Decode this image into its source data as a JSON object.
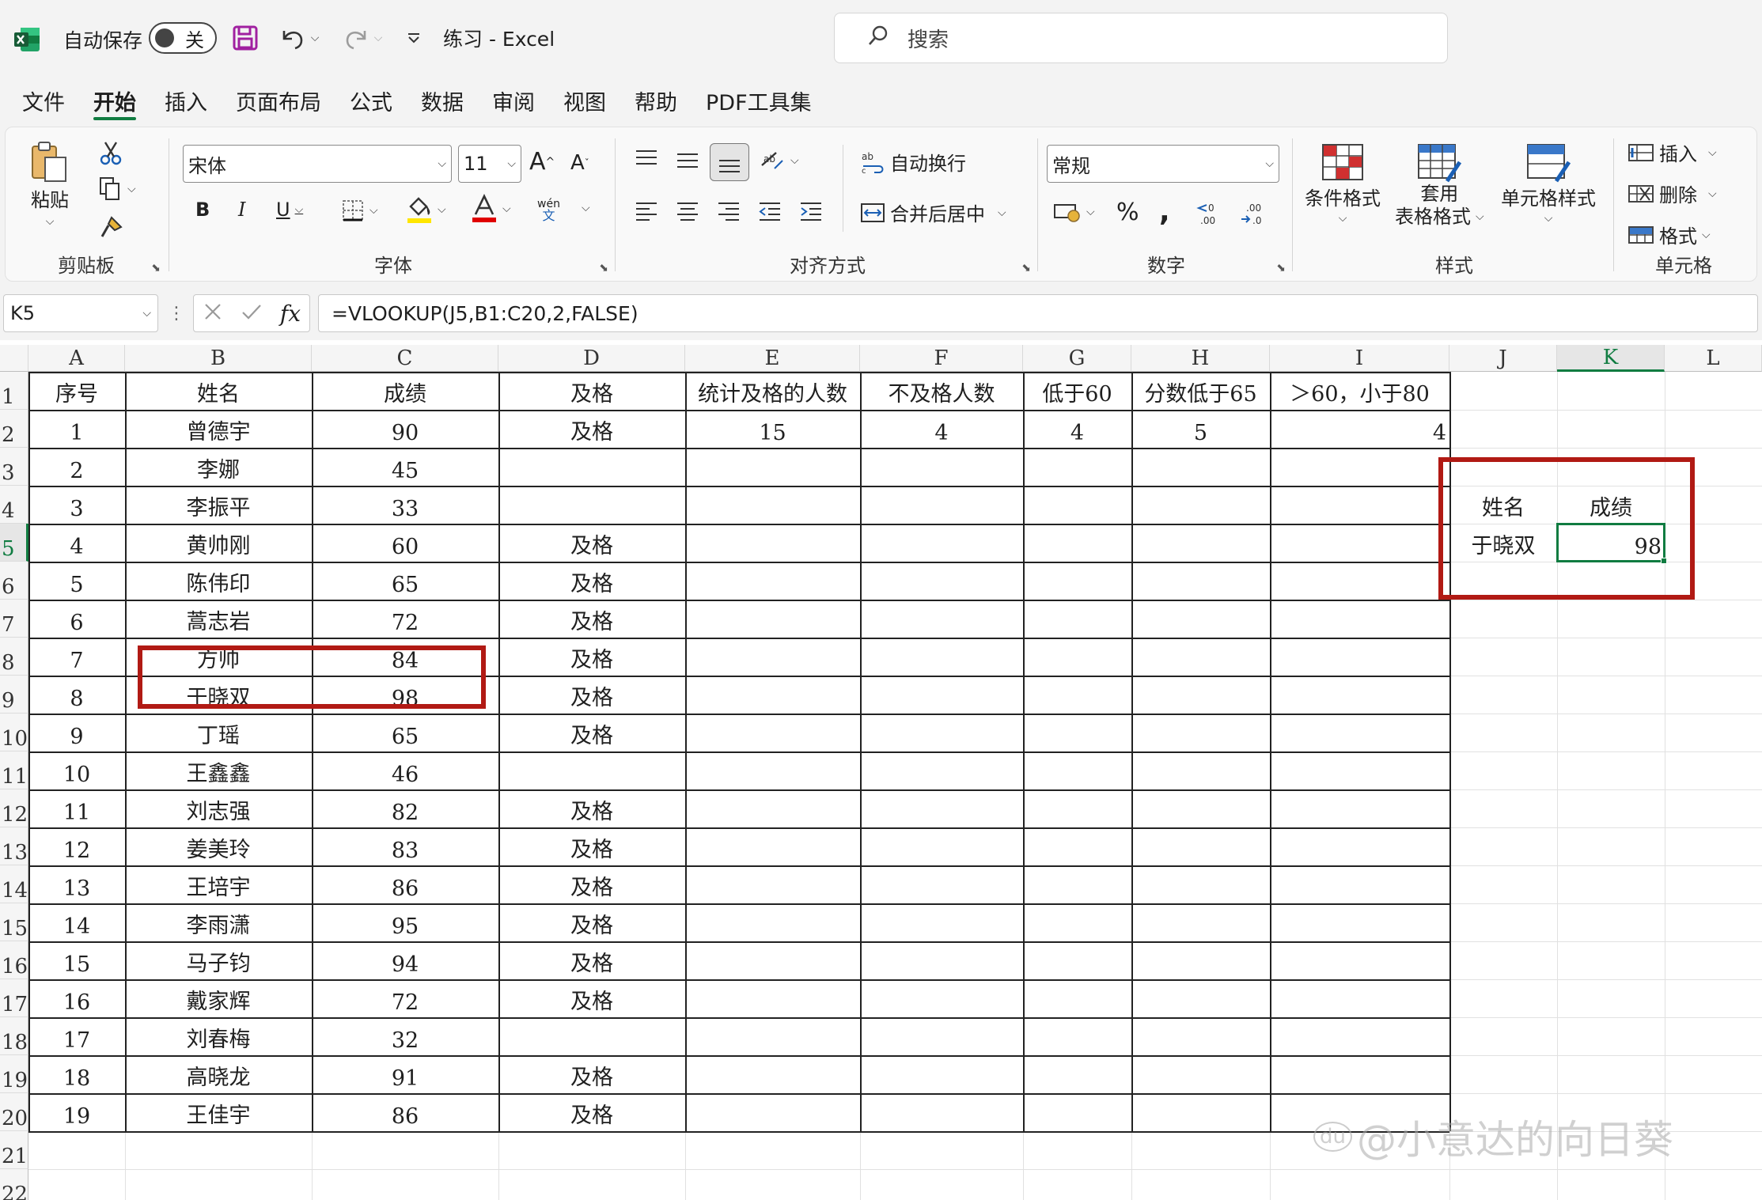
{
  "app": {
    "autosave_label": "自动保存",
    "autosave_state": "关",
    "doc_title": "练习  -  Excel",
    "search_placeholder": "搜索"
  },
  "tabs": [
    "文件",
    "开始",
    "插入",
    "页面布局",
    "公式",
    "数据",
    "审阅",
    "视图",
    "帮助",
    "PDF工具集"
  ],
  "ribbon": {
    "clipboard": {
      "label": "剪贴板",
      "paste": "粘贴"
    },
    "font": {
      "label": "字体",
      "font_name": "宋体",
      "font_size": "11",
      "bold": "B",
      "italic": "I",
      "underline": "U",
      "phonetic_top": "wén",
      "phonetic_bottom": "文",
      "font_color": "#e00000",
      "highlight_color": "#ffe600"
    },
    "alignment": {
      "label": "对齐方式",
      "wrap_text": "自动换行",
      "merge_center": "合并后居中"
    },
    "number": {
      "label": "数字",
      "format": "常规"
    },
    "styles": {
      "label": "样式",
      "conditional": "条件格式",
      "table_line1": "套用",
      "table_line2": "表格格式",
      "cell_styles": "单元格样式"
    },
    "cells": {
      "label": "单元格",
      "insert": "插入",
      "delete": "删除",
      "format": "格式"
    }
  },
  "formula_bar": {
    "name_box": "K5",
    "formula": "=VLOOKUP(J5,B1:C20,2,FALSE)"
  },
  "columns": [
    "A",
    "B",
    "C",
    "D",
    "E",
    "F",
    "G",
    "H",
    "I",
    "J",
    "K",
    "L"
  ],
  "rows": [
    "1",
    "2",
    "3",
    "4",
    "5",
    "6",
    "7",
    "8",
    "9",
    "10",
    "11",
    "12",
    "13",
    "14",
    "15",
    "16",
    "17",
    "18",
    "19",
    "20",
    "21",
    "22"
  ],
  "headers": {
    "A": "序号",
    "B": "姓名",
    "C": "成绩",
    "D": "及格",
    "E": "统计及格的人数",
    "F": "不及格人数",
    "G": "低于60",
    "H": "分数低于65",
    "I": "＞60，小于80"
  },
  "stats_row": {
    "E": "15",
    "F": "4",
    "G": "4",
    "H": "5",
    "I": "4"
  },
  "students": [
    {
      "no": "1",
      "name": "曾德宇",
      "score": "90",
      "pass": "及格"
    },
    {
      "no": "2",
      "name": "李娜",
      "score": "45",
      "pass": ""
    },
    {
      "no": "3",
      "name": "李振平",
      "score": "33",
      "pass": ""
    },
    {
      "no": "4",
      "name": "黄帅刚",
      "score": "60",
      "pass": "及格"
    },
    {
      "no": "5",
      "name": "陈伟印",
      "score": "65",
      "pass": "及格"
    },
    {
      "no": "6",
      "name": "蒿志岩",
      "score": "72",
      "pass": "及格"
    },
    {
      "no": "7",
      "name": "方帅",
      "score": "84",
      "pass": "及格"
    },
    {
      "no": "8",
      "name": "于晓双",
      "score": "98",
      "pass": "及格"
    },
    {
      "no": "9",
      "name": "丁瑶",
      "score": "65",
      "pass": "及格"
    },
    {
      "no": "10",
      "name": "王鑫鑫",
      "score": "46",
      "pass": ""
    },
    {
      "no": "11",
      "name": "刘志强",
      "score": "82",
      "pass": "及格"
    },
    {
      "no": "12",
      "name": "姜美玲",
      "score": "83",
      "pass": "及格"
    },
    {
      "no": "13",
      "name": "王培宇",
      "score": "86",
      "pass": "及格"
    },
    {
      "no": "14",
      "name": "李雨潇",
      "score": "95",
      "pass": "及格"
    },
    {
      "no": "15",
      "name": "马子钧",
      "score": "94",
      "pass": "及格"
    },
    {
      "no": "16",
      "name": "戴家辉",
      "score": "72",
      "pass": "及格"
    },
    {
      "no": "17",
      "name": "刘春梅",
      "score": "32",
      "pass": ""
    },
    {
      "no": "18",
      "name": "高晓龙",
      "score": "91",
      "pass": "及格"
    },
    {
      "no": "19",
      "name": "王佳宇",
      "score": "86",
      "pass": "及格"
    }
  ],
  "lookup": {
    "name_header": "姓名",
    "score_header": "成绩",
    "name_value": "于晓双",
    "score_value": "98"
  },
  "watermark": "@小意达的向日葵",
  "watermark_badge": "du",
  "colors": {
    "excel_green": "#107c41",
    "annotation_red": "#b11a14"
  }
}
